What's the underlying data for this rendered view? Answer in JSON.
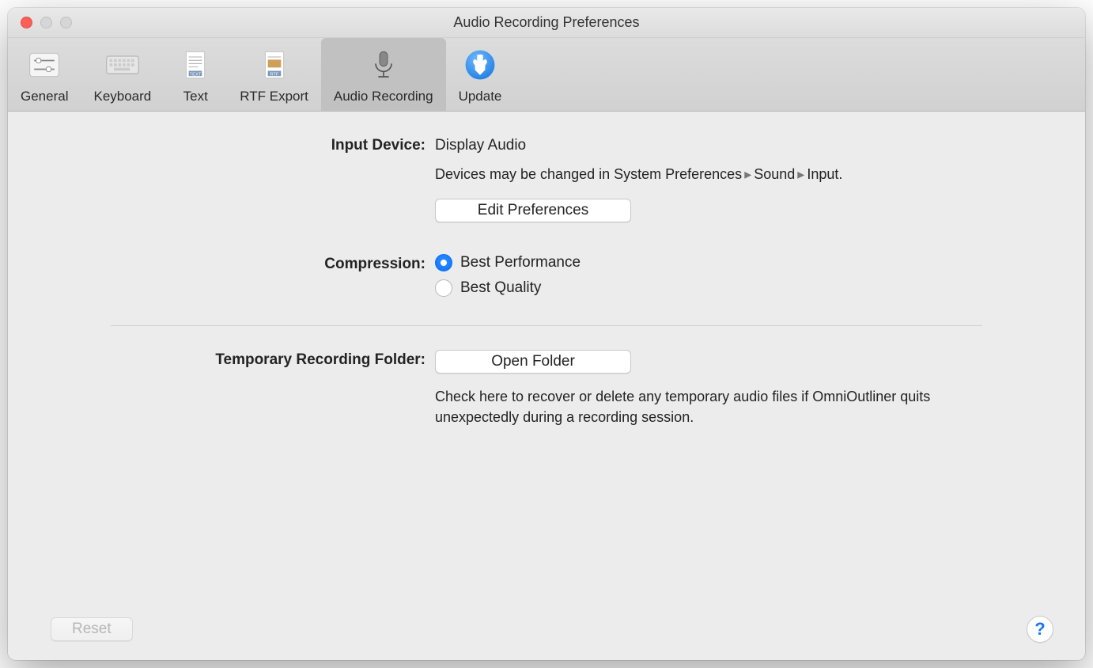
{
  "window": {
    "title": "Audio Recording Preferences"
  },
  "toolbar": {
    "items": [
      {
        "label": "General"
      },
      {
        "label": "Keyboard"
      },
      {
        "label": "Text"
      },
      {
        "label": "RTF Export"
      },
      {
        "label": "Audio Recording"
      },
      {
        "label": "Update"
      }
    ],
    "active_index": 4
  },
  "input_device": {
    "label": "Input Device:",
    "value": "Display Audio",
    "hint_prefix": "Devices may be changed in ",
    "breadcrumb": [
      "System Preferences",
      "Sound",
      "Input"
    ],
    "hint_suffix": ".",
    "edit_button": "Edit Preferences"
  },
  "compression": {
    "label": "Compression:",
    "options": [
      "Best Performance",
      "Best Quality"
    ],
    "selected_index": 0
  },
  "temp_folder": {
    "label": "Temporary Recording Folder:",
    "button": "Open Folder",
    "hint": "Check here to recover or delete any temporary audio files if OmniOutliner quits unexpectedly during a recording session."
  },
  "footer": {
    "reset": "Reset",
    "help": "?"
  }
}
